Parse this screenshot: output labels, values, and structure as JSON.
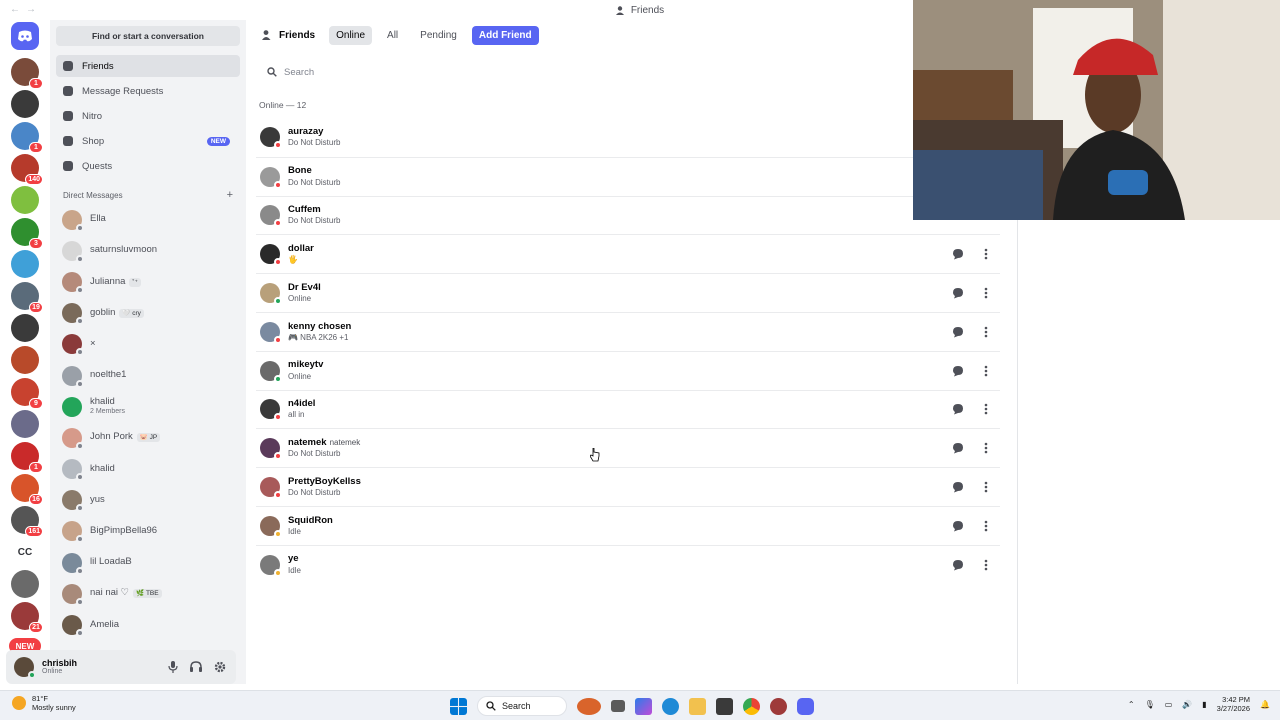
{
  "window": {
    "title": "Friends"
  },
  "colors": {
    "brand": "#5865f2",
    "dnd": "#f23f43",
    "online": "#23a55a",
    "idle": "#f0b232",
    "offline": "#80848e"
  },
  "servers": [
    {
      "color": "#7a4b3a",
      "badge": "1"
    },
    {
      "color": "#3a3a3a",
      "badge": ""
    },
    {
      "color": "#4a86c8",
      "badge": "1"
    },
    {
      "color": "#b63a2b",
      "badge": "140"
    },
    {
      "color": "#7fbf3f",
      "badge": ""
    },
    {
      "color": "#2f8f2f",
      "badge": "3"
    },
    {
      "color": "#3fa0d8",
      "badge": ""
    },
    {
      "color": "#5a6b7a",
      "badge": "19"
    },
    {
      "color": "#3a3a3a",
      "badge": ""
    },
    {
      "color": "#b84a2a",
      "badge": ""
    },
    {
      "color": "#c8422f",
      "badge": "9"
    },
    {
      "color": "#6b6b8a",
      "badge": ""
    },
    {
      "color": "#c92a2a",
      "badge": "1"
    },
    {
      "color": "#d8542a",
      "badge": "16"
    },
    {
      "color": "#555555",
      "badge": "161"
    }
  ],
  "server_text": "CC",
  "servers_after": [
    {
      "color": "#6a6a6a",
      "badge": ""
    },
    {
      "color": "#9a3a3a",
      "badge": "21"
    }
  ],
  "server_new": "NEW",
  "sidebar": {
    "find": "Find or start a conversation",
    "nav": [
      {
        "label": "Friends",
        "icon": "friends-icon",
        "active": true
      },
      {
        "label": "Message Requests",
        "icon": "mail-icon",
        "active": false
      },
      {
        "label": "Nitro",
        "icon": "nitro-icon",
        "active": false
      },
      {
        "label": "Shop",
        "icon": "shop-icon",
        "active": false,
        "tag": "NEW"
      },
      {
        "label": "Quests",
        "icon": "quests-icon",
        "active": false
      }
    ],
    "dm_header": "Direct Messages",
    "dm_add": "+",
    "dms": [
      {
        "name": "Ella",
        "sub": "",
        "tag": "",
        "color": "#c9a58a",
        "status": "#80848e"
      },
      {
        "name": "saturnsluvmoon",
        "sub": "",
        "tag": "",
        "color": "#d7d7d7",
        "status": "#80848e"
      },
      {
        "name": "Julianna",
        "sub": "",
        "tag": "˚⁺",
        "color": "#b58a7a",
        "status": "#80848e"
      },
      {
        "name": "goblin",
        "sub": "",
        "tag": "🤍 cry",
        "color": "#7a6a5a",
        "status": "#80848e"
      },
      {
        "name": "×",
        "sub": "",
        "tag": "",
        "color": "#8a3a3a",
        "status": "#80848e"
      },
      {
        "name": "noelthe1",
        "sub": "",
        "tag": "",
        "color": "#9aa0a8",
        "status": "#80848e"
      },
      {
        "name": "khalid",
        "sub": "2 Members",
        "tag": "",
        "color": "#23a55a",
        "status": ""
      },
      {
        "name": "John Pork",
        "sub": "",
        "tag": "🐷 JP",
        "color": "#d69a8a",
        "status": "#80848e"
      },
      {
        "name": "khalid",
        "sub": "",
        "tag": "",
        "color": "#b5bac1",
        "status": "#80848e"
      },
      {
        "name": "yus",
        "sub": "",
        "tag": "",
        "color": "#8a7a6a",
        "status": "#80848e"
      },
      {
        "name": "BigPimpBella96",
        "sub": "",
        "tag": "",
        "color": "#c7a38a",
        "status": "#80848e"
      },
      {
        "name": "lil LoadaB",
        "sub": "",
        "tag": "",
        "color": "#7a8a9a",
        "status": "#80848e"
      },
      {
        "name": "nai nai ♡",
        "sub": "",
        "tag": "🌿 TBE",
        "color": "#a88a7a",
        "status": "#80848e"
      },
      {
        "name": "Amelia",
        "sub": "",
        "tag": "",
        "color": "#6a5a4a",
        "status": "#80848e"
      }
    ]
  },
  "user": {
    "name": "chrisbih",
    "status": "Online",
    "color": "#5a4a3a"
  },
  "header": {
    "title": "Friends",
    "tabs": [
      {
        "label": "Online",
        "selected": true
      },
      {
        "label": "All",
        "selected": false
      },
      {
        "label": "Pending",
        "selected": false
      }
    ],
    "add_friend": "Add Friend"
  },
  "search": {
    "placeholder": "Search"
  },
  "online_header": "Online — 12",
  "friends": [
    {
      "name": "aurazay",
      "alt": "",
      "status": "Do Not Disturb",
      "state": "dnd",
      "color": "#3a3a3a",
      "actions": false
    },
    {
      "name": "Bone",
      "alt": "",
      "status": "Do Not Disturb",
      "state": "dnd",
      "color": "#9a9a9a",
      "actions": false
    },
    {
      "name": "Cuffem",
      "alt": "",
      "status": "Do Not Disturb",
      "state": "dnd",
      "color": "#8a8a8a",
      "actions": false
    },
    {
      "name": "dollar",
      "alt": "",
      "status": "🖐",
      "state": "dnd",
      "color": "#2a2a2a",
      "actions": true
    },
    {
      "name": "Dr Ev4l",
      "alt": "",
      "status": "Online",
      "state": "online",
      "color": "#b8a07a",
      "actions": true
    },
    {
      "name": "kenny chosen",
      "alt": "",
      "status": "🎮 NBA 2K26 +1",
      "state": "dnd",
      "color": "#7a8aa0",
      "actions": true
    },
    {
      "name": "mikeytv",
      "alt": "",
      "status": "Online",
      "state": "online",
      "color": "#6a6a6a",
      "actions": true
    },
    {
      "name": "n4idel",
      "alt": "",
      "status": "all in",
      "state": "dnd",
      "color": "#3a3a3a",
      "actions": true
    },
    {
      "name": "natemek",
      "alt": "natemek",
      "status": "Do Not Disturb",
      "state": "dnd",
      "color": "#5a3a5a",
      "actions": true
    },
    {
      "name": "PrettyBoyKellss",
      "alt": "",
      "status": "Do Not Disturb",
      "state": "dnd",
      "color": "#a85a5a",
      "actions": true
    },
    {
      "name": "SquidRon",
      "alt": "",
      "status": "Idle",
      "state": "idle",
      "color": "#8a6a5a",
      "actions": true
    },
    {
      "name": "ye",
      "alt": "",
      "status": "Idle",
      "state": "idle",
      "color": "#7a7a7a",
      "actions": true
    }
  ],
  "taskbar": {
    "weather_temp": "81°F",
    "weather_desc": "Mostly sunny",
    "search": "Search",
    "time": "3:42 PM",
    "date": "3/27/2026"
  }
}
